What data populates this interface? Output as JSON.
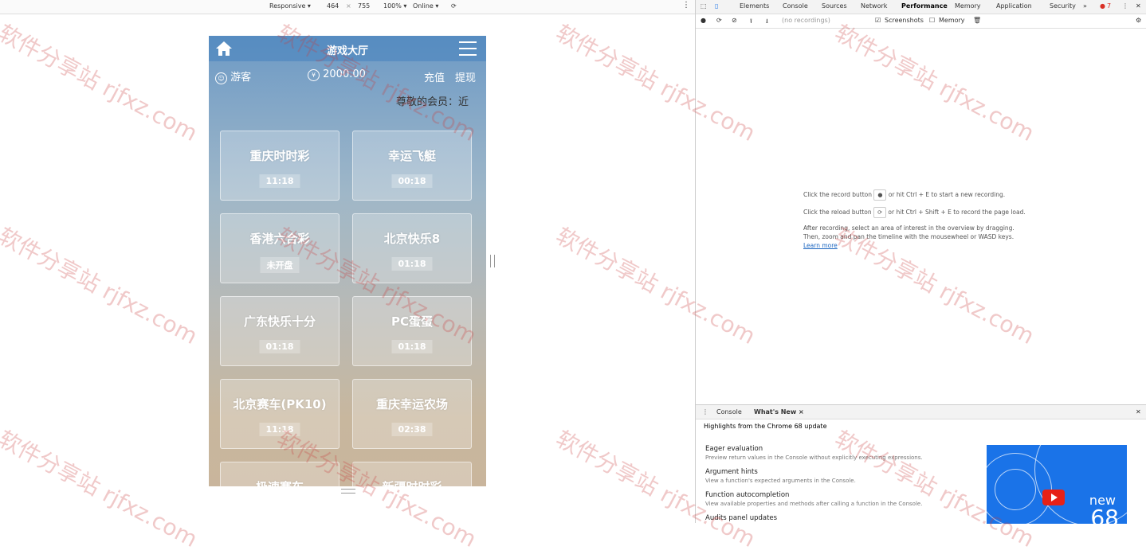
{
  "devbar": {
    "device": "Responsive ▾",
    "width": "464",
    "x": "×",
    "height": "755",
    "zoom": "100% ▾",
    "network": "Online ▾"
  },
  "phone": {
    "title": "游戏大厅",
    "user": "游客",
    "balance": "2000.00",
    "recharge": "充值",
    "withdraw": "提现",
    "marquee": "尊敬的会员：近",
    "games": [
      {
        "name": "重庆时时彩",
        "time": "11:18"
      },
      {
        "name": "幸运飞艇",
        "time": "00:18"
      },
      {
        "name": "香港六合彩",
        "time": "未开盘"
      },
      {
        "name": "北京快乐8",
        "time": "01:18"
      },
      {
        "name": "广东快乐十分",
        "time": "01:18"
      },
      {
        "name": "PC蛋蛋",
        "time": "01:18"
      },
      {
        "name": "北京赛车(PK10)",
        "time": "11:18"
      },
      {
        "name": "重庆幸运农场",
        "time": "02:38"
      },
      {
        "name": "极速赛车",
        "time": ""
      },
      {
        "name": "新疆时时彩",
        "time": ""
      }
    ]
  },
  "devtools": {
    "tabs": [
      "Elements",
      "Console",
      "Sources",
      "Network",
      "Performance",
      "Memory",
      "Application",
      "Security",
      "»"
    ],
    "active_tab": "Performance",
    "error_count": "7",
    "toolbar": {
      "recording": "(no recordings)",
      "screenshots": "Screenshots",
      "memory": "Memory"
    },
    "instructions": {
      "line1a": "Click the record button",
      "line1b": "or hit Ctrl + E to start a new recording.",
      "line2a": "Click the reload button",
      "line2b": "or hit Ctrl + Shift + E to record the page load.",
      "line3": "After recording, select an area of interest in the overview by dragging.",
      "line4": "Then, zoom and pan the timeline with the mousewheel or WASD keys.",
      "learn_more": "Learn more"
    },
    "drawer": {
      "tab_console": "Console",
      "tab_whatsnew": "What's New ×",
      "heading": "Highlights from the Chrome 68 update",
      "items": [
        {
          "title": "Eager evaluation",
          "desc": "Preview return values in the Console without explicitly executing expressions."
        },
        {
          "title": "Argument hints",
          "desc": "View a function's expected arguments in the Console."
        },
        {
          "title": "Function autocompletion",
          "desc": "View available properties and methods after calling a function in the Console."
        },
        {
          "title": "Audits panel updates",
          "desc": ""
        }
      ],
      "promo_new": "new",
      "promo_version": "68"
    }
  },
  "watermark": "软件分享站 rjfxz.com"
}
